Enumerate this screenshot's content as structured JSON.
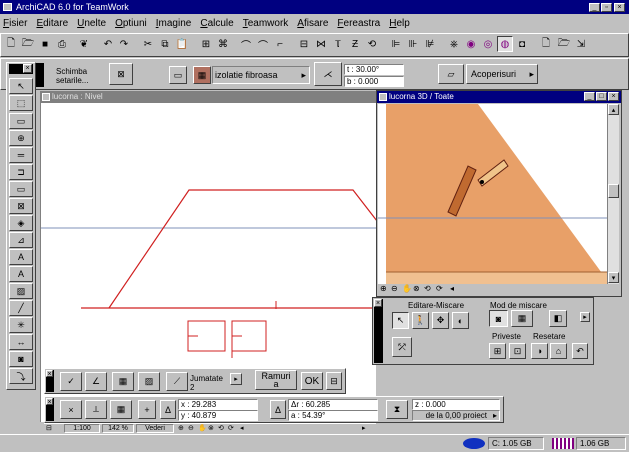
{
  "app": {
    "title": "ArchiCAD 6.0 for TeamWork"
  },
  "menu": [
    "Fisier",
    "Editare",
    "Unelte",
    "Optiuni",
    "Imagine",
    "Calcule",
    "Teamwork",
    "Afisare",
    "Fereastra",
    "Help"
  ],
  "infobox": {
    "settings_label": "Schimba setarile...",
    "material": "izolatie fibroasa",
    "angle_t": "t : 30.00°",
    "angle_b": "b : 0.000",
    "roof_type": "Acoperisuri"
  },
  "plan_window": {
    "title": "lucorna : Nivel"
  },
  "view3d_window": {
    "title": "lucorna 3D / Toate"
  },
  "nav_palette": {
    "edit_move_label": "Editare-Miscare",
    "move_mode_label": "Mod de miscare",
    "view_label": "Priveste",
    "reset_label": "Resetare"
  },
  "control_box": {
    "halfway_label": "Jumatate",
    "halfway_value": "2",
    "remain_label": "Ramuri",
    "remain_value": "a",
    "ok_label": "OK"
  },
  "coords": {
    "x": "x : 29.283",
    "y": "y : 40.879",
    "dr": "Δr : 60.285",
    "a": "a : 54.39°",
    "z": "z : 0.000",
    "ref": "de la 0,00 proiect"
  },
  "plan_status": {
    "scale": "1:100",
    "zoom": "142 %",
    "view": "Vederi"
  },
  "status": {
    "disk1": "C: 1.05 GB",
    "disk2": "1.06 GB"
  },
  "colors": {
    "titlebar": "#000080",
    "roof": "#e8a068",
    "drawing": "#d02020",
    "grid": "#7f90b8"
  }
}
